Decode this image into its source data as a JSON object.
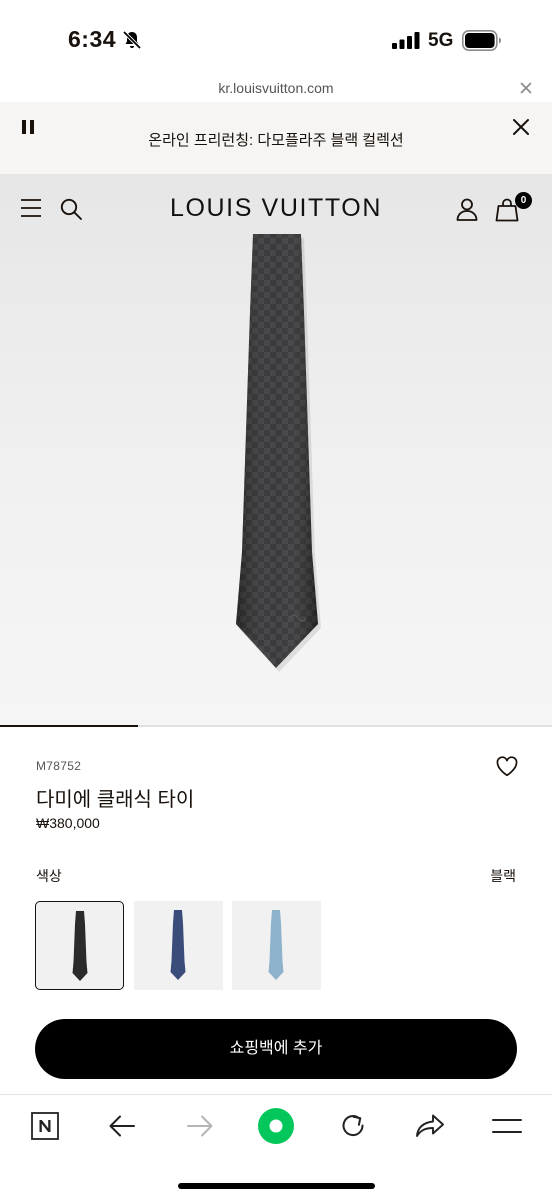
{
  "status_bar": {
    "time": "6:34",
    "network": "5G"
  },
  "url_bar": {
    "url": "kr.louisvuitton.com"
  },
  "promo": {
    "text": "온라인 프리런칭: 다모플라주 블랙 컬렉션"
  },
  "header": {
    "brand": "LOUIS VUITTON",
    "cart_count": "0"
  },
  "product": {
    "sku": "M78752",
    "name": "다미에 클래식 타이",
    "price": "₩380,000",
    "color_label": "색상",
    "color_value": "블랙",
    "swatches": [
      {
        "name": "black",
        "color": "#2b2b2b",
        "selected": true
      },
      {
        "name": "navy",
        "color": "#3a4d7a",
        "selected": false
      },
      {
        "name": "light-blue",
        "color": "#8eb2cc",
        "selected": false
      }
    ],
    "add_to_bag": "쇼핑백에 추가"
  },
  "carousel": {
    "current": 1,
    "total": 4
  },
  "toolbar": {
    "icons": [
      "naver-n-icon",
      "back-arrow-icon",
      "forward-arrow-icon",
      "home-dot-icon",
      "reload-icon",
      "share-icon",
      "menu-icon"
    ]
  }
}
